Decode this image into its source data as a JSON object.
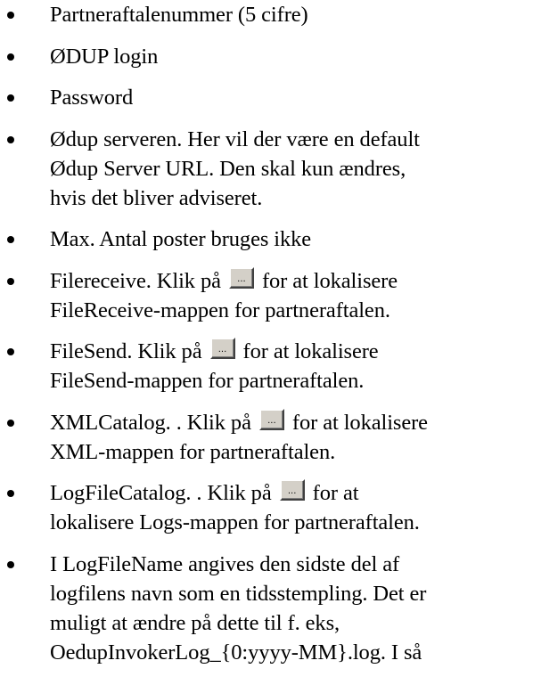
{
  "items": [
    {
      "lines": [
        "Partneraftalenummer (5 cifre)"
      ]
    },
    {
      "lines": [
        "ØDUP login"
      ]
    },
    {
      "lines": [
        "Password"
      ]
    },
    {
      "lines": [
        "Ødup serveren. Her vil der være en default",
        "Ødup Server URL. Den skal kun ændres,",
        "hvis det bliver adviseret."
      ]
    },
    {
      "lines": [
        "Max. Antal poster bruges ikke"
      ]
    },
    {
      "before": "Filereceive. Klik på",
      "after": "for at lokalisere",
      "lines": [
        "FileReceive-mappen for partneraftalen."
      ]
    },
    {
      "before": "FileSend. Klik på",
      "after": "for at lokalisere",
      "lines": [
        "FileSend-mappen for partneraftalen."
      ]
    },
    {
      "before": "XMLCatalog. . Klik på",
      "after": "for at lokalisere",
      "lines": [
        "XML-mappen for partneraftalen."
      ]
    },
    {
      "before": "LogFileCatalog. . Klik på",
      "after": "for at",
      "lines": [
        "lokalisere Logs-mappen for partneraftalen."
      ]
    },
    {
      "lines": [
        "I LogFileName angives den sidste del af",
        "logfilens navn som en tidsstempling. Det er",
        "muligt at ændre på dette til f. eks,",
        "OedupInvokerLog_{0:yyyy-MM}.log. I så"
      ]
    }
  ],
  "browse_button": {
    "label": "...",
    "icon": "ellipsis-browse-button"
  }
}
